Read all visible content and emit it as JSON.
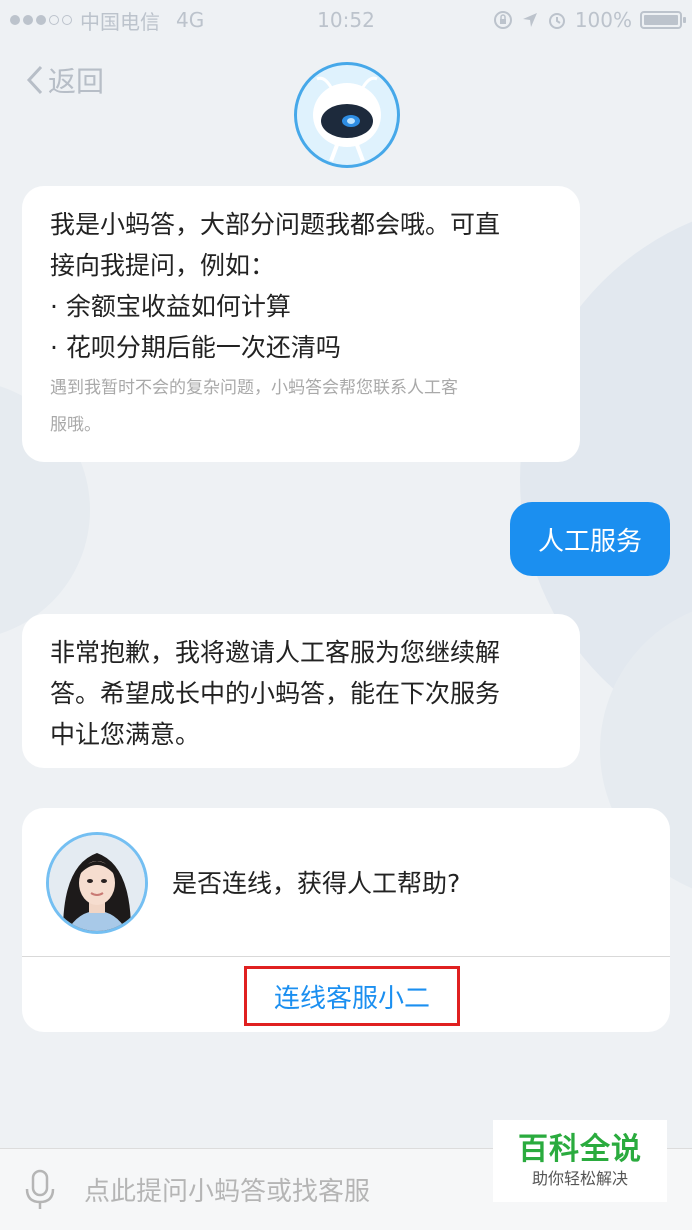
{
  "status_bar": {
    "carrier": "中国电信",
    "network": "4G",
    "time": "10:52",
    "battery": "100%",
    "signal_filled": 3,
    "signal_total": 5
  },
  "header": {
    "back_label": "返回",
    "back_icon": "chevron-left-icon",
    "avatar_icon": "robot-avatar-icon"
  },
  "messages": {
    "bot_intro": {
      "line1": "我是小蚂答，大部分问题我都会哦。可直",
      "line2": "接向我提问，例如：",
      "example1": "· 余额宝收益如何计算",
      "example2": "· 花呗分期后能一次还清吗",
      "note_line1": "遇到我暂时不会的复杂问题，小蚂答会帮您联系人工客",
      "note_line2": "服哦。"
    },
    "user_reply": "人工服务",
    "bot_apology": {
      "line1": "非常抱歉，我将邀请人工客服为您继续解",
      "line2": "答。希望成长中的小蚂答，能在下次服务",
      "line3": "中让您满意。"
    }
  },
  "connect_card": {
    "question": "是否连线，获得人工帮助?",
    "button_label": "连线客服小二",
    "highlight_color": "#e02020"
  },
  "input_bar": {
    "placeholder": "点此提问小蚂答或找客服",
    "mic_icon": "microphone-icon"
  },
  "watermark": {
    "title": "百科全说",
    "subtitle": "助你轻松解决"
  },
  "colors": {
    "accent": "#1b8ff0",
    "background": "#eef1f4",
    "watermark_green": "#2aab3e"
  }
}
